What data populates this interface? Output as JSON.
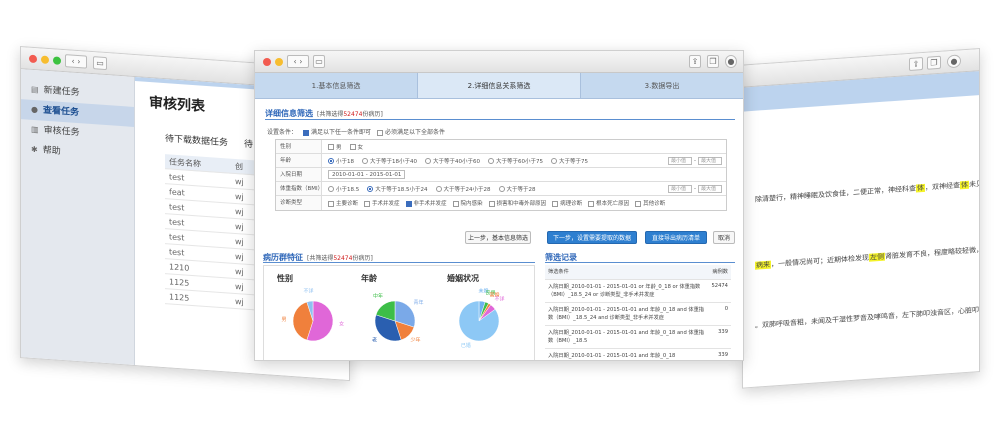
{
  "left_window": {
    "sidebar": [
      {
        "icon": "file-icon",
        "label": "新建任务"
      },
      {
        "icon": "eye-icon",
        "label": "查看任务"
      },
      {
        "icon": "chart-icon",
        "label": "审核任务"
      },
      {
        "icon": "gear-icon",
        "label": "帮助"
      }
    ],
    "page_title": "审核列表",
    "tabs": [
      "待下载数据任务",
      "待"
    ],
    "table_header": [
      "任务名称",
      "创"
    ],
    "rows": [
      [
        "test",
        "wj"
      ],
      [
        "feat",
        "wj"
      ],
      [
        "test",
        "wj"
      ],
      [
        "test",
        "wj"
      ],
      [
        "test",
        "wj"
      ],
      [
        "test",
        "wj"
      ],
      [
        "1210",
        "wj"
      ],
      [
        "1125",
        "wj"
      ],
      [
        "1125",
        "wj"
      ]
    ]
  },
  "main_window": {
    "steps": [
      "1.基本信息筛选",
      "2.详细信息关系筛选",
      "3.数据导出"
    ],
    "detail_section": {
      "title": "详细信息筛选",
      "count_prefix": "[共筛选得",
      "count": "52474",
      "count_suffix": "份病历]"
    },
    "condition": {
      "label": "设置条件：",
      "opt1": "满足以下任一条件即可",
      "opt2": "必须满足以下全部条件"
    },
    "filters": {
      "gender": {
        "label": "性别",
        "opts": [
          "男",
          "女"
        ]
      },
      "age": {
        "label": "年龄",
        "opts": [
          "小于18",
          "大于等于18小于40",
          "大于等于40小于60",
          "大于等于60小于75",
          "大于等于75"
        ],
        "min_ph": "最小值",
        "max_ph": "最大值"
      },
      "admit_date": {
        "label": "入院日期",
        "value": "2010-01-01 - 2015-01-01"
      },
      "bmi": {
        "label": "体重指数（BMI）",
        "opts": [
          "小于18.5",
          "大于等于18.5小于24",
          "大于等于24小于28",
          "大于等于28"
        ],
        "min_ph": "最小值",
        "max_ph": "最大值"
      },
      "diagnosis": {
        "label": "诊断类型",
        "opts": [
          "主要诊断",
          "手术并发症",
          "非手术并发症",
          "院内感染",
          "损害和中毒外部原因",
          "病理诊断",
          "根本死亡原因",
          "其他诊断"
        ]
      }
    },
    "buttons": {
      "prev": "上一步，基本信息筛选",
      "next": "下一步，设置需要提取的数据",
      "export": "直接导出病历清单",
      "cancel": "取消"
    },
    "features": {
      "title": "病历群特征",
      "count_prefix": "[共筛选得",
      "count": "52474",
      "count_suffix": "份病历]"
    },
    "charts": {
      "gender": {
        "title": "性别",
        "labels": [
          "女",
          "男",
          "不详"
        ]
      },
      "age": {
        "title": "年龄",
        "labels": [
          "青年",
          "少年",
          "老",
          "中年"
        ]
      },
      "marriage": {
        "title": "婚姻状况",
        "labels": [
          "未婚",
          "丧偶",
          "离婚",
          "不详",
          "已婚"
        ]
      }
    },
    "records": {
      "title": "筛选记录",
      "header": [
        "筛选条件",
        "病例数"
      ],
      "rows": [
        {
          "text": "入院日期_2010-01-01 - 2015-01-01 or 年龄_0_18 or 体重指数（BMI）_18.5_24 or 诊断类型_非手术并发症",
          "count": "52474"
        },
        {
          "text": "入院日期_2010-01-01 - 2015-01-01 and 年龄_0_18 and 体重指数（BMI）_18.5_24 and 诊断类型_非手术并发症",
          "count": "0"
        },
        {
          "text": "入院日期_2010-01-01 - 2015-01-01 and 年龄_0_18 and 体重指数（BMI）_18.5",
          "count": "339"
        },
        {
          "text": "入院日期_2010-01-01 - 2015-01-01 and 年龄_0_18",
          "count": "339"
        }
      ]
    }
  },
  "chart_data": [
    {
      "type": "pie",
      "title": "性别",
      "categories": [
        "女",
        "男",
        "不详"
      ],
      "values": [
        55,
        40,
        5
      ]
    },
    {
      "type": "pie",
      "title": "年龄",
      "categories": [
        "青年",
        "少年",
        "老",
        "中年"
      ],
      "values": [
        30,
        15,
        35,
        20
      ]
    },
    {
      "type": "pie",
      "title": "婚姻状况",
      "categories": [
        "未婚",
        "丧偶",
        "离婚",
        "不详",
        "已婚"
      ],
      "values": [
        5,
        3,
        2,
        5,
        85
      ]
    }
  ],
  "right_window": {
    "lines": [
      {
        "a": "除清楚行，精神睡眠及饮食佳，二便正常，神经科查",
        "hl": "体",
        "b": "，双神经查",
        "hl2": "体",
        "c": "未见异常。"
      },
      {
        "a": "",
        "hl": "病来",
        "b": "，一般情况尚可；近期体检发现",
        "hl2": "左侧",
        "c": "肾脏发育不良，程度略较轻微，查",
        "hl3": "体"
      },
      {
        "a": "。双肺呼吸音粗，未闻及干湿性罗音及哮鸣音，左下肺叩浊音区，心脏叩诊界正常"
      }
    ]
  }
}
